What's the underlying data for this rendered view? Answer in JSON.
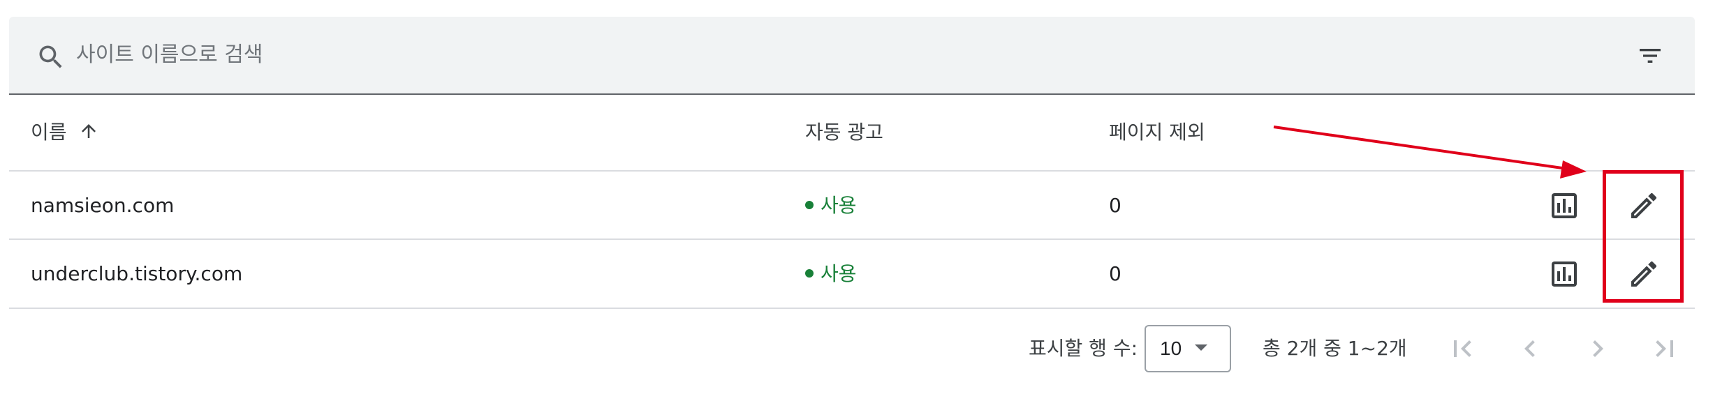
{
  "search": {
    "placeholder": "사이트 이름으로 검색"
  },
  "table": {
    "columns": {
      "name": "이름",
      "auto_ads": "자동 광고",
      "page_exclusions": "페이지 제외"
    },
    "sort_icon": "arrow-up-icon",
    "rows": [
      {
        "name": "namsieon.com",
        "auto_ads_status": "사용",
        "page_exclusions": "0"
      },
      {
        "name": "underclub.tistory.com",
        "auto_ads_status": "사용",
        "page_exclusions": "0"
      }
    ]
  },
  "pagination": {
    "rows_per_page_label": "표시할 행 수:",
    "rows_per_page_value": "10",
    "range_text": "총 2개 중 1~2개"
  },
  "colors": {
    "status_green": "#188038",
    "annotation_red": "#e0001a",
    "search_bg": "#f1f3f4"
  },
  "icons": {
    "search": "search-icon",
    "filter": "filter-icon",
    "report": "bar-chart-icon",
    "edit": "pencil-icon",
    "first": "first-page-icon",
    "prev": "chevron-left-icon",
    "next": "chevron-right-icon",
    "last": "last-page-icon"
  }
}
